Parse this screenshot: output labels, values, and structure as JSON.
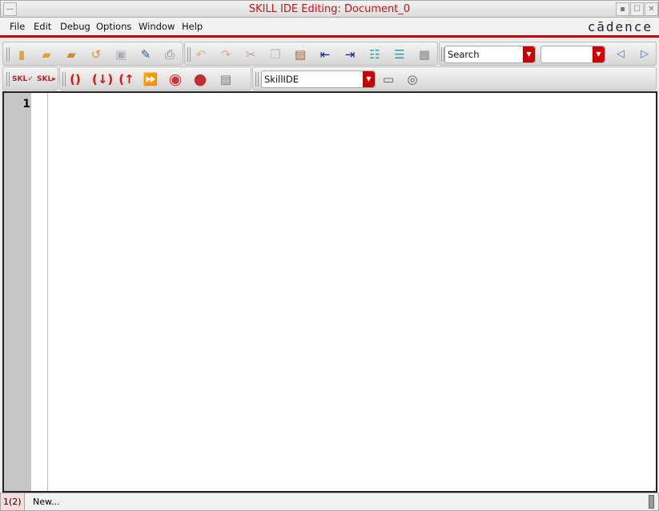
{
  "window": {
    "title": "SKILL IDE Editing: Document_0",
    "controls": [
      "minimize",
      "maximize",
      "close"
    ]
  },
  "menu": {
    "items": [
      "File",
      "Edit",
      "Debug",
      "Options",
      "Window",
      "Help"
    ],
    "logo": "cādence"
  },
  "toolbar1": {
    "icons": [
      "new-file-icon",
      "open-folder-icon",
      "open-folder-add-icon",
      "revert-icon",
      "save-icon",
      "save-as-icon",
      "print-icon",
      "undo-icon",
      "redo-icon",
      "cut-icon",
      "copy-icon",
      "paste-icon",
      "unindent-icon",
      "indent-icon",
      "comment-icon",
      "uncomment-icon",
      "properties-icon"
    ],
    "search_value": "Search",
    "search2_value": ""
  },
  "toolbar2": {
    "icons": [
      "load-skill-icon",
      "run-skill-icon",
      "step-over-icon",
      "step-in-icon",
      "step-out-icon",
      "continue-icon",
      "stop-icon",
      "abort-icon",
      "stack-icon"
    ],
    "context_value": "SkillIDE"
  },
  "editor": {
    "line_numbers": [
      "1"
    ],
    "content": ""
  },
  "status": {
    "count": "1(2)",
    "message": "New..."
  },
  "colors": {
    "accent": "#c80000",
    "title": "#d01010"
  }
}
